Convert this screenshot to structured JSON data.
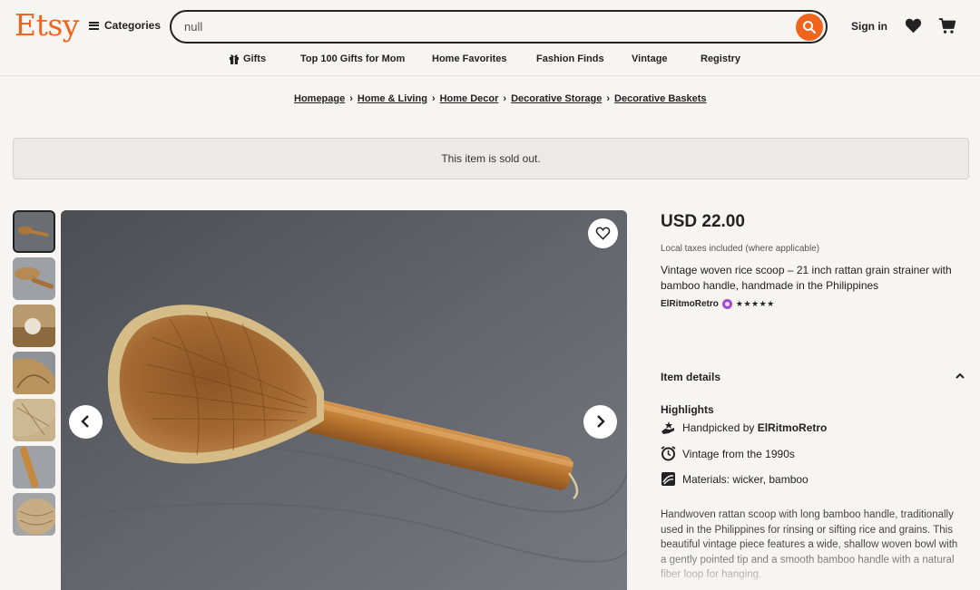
{
  "header": {
    "logo": "Etsy",
    "categories_label": "Categories",
    "search_value": "null",
    "signin_label": "Sign in"
  },
  "subnav": [
    "Gifts",
    "Top 100 Gifts for Mom",
    "Home Favorites",
    "Fashion Finds",
    "Vintage",
    "Registry"
  ],
  "breadcrumb": [
    "Homepage",
    "Home & Living",
    "Home Decor",
    "Decorative Storage",
    "Decorative Baskets"
  ],
  "banner": {
    "text": "This item is sold out."
  },
  "listing": {
    "price": "USD 22.00",
    "tax_note": "Local taxes included (where applicable)",
    "title": "Vintage woven rice scoop – 21 inch rattan grain strainer with bamboo handle, handmade in the Philippines",
    "shop_name": "ElRitmoRetro",
    "stars": "★★★★★"
  },
  "details": {
    "heading": "Item details",
    "highlights_heading": "Highlights",
    "handpicked_prefix": "Handpicked by ",
    "handpicked_shop": "ElRitmoRetro",
    "vintage": "Vintage from the 1990s",
    "materials": "Materials: wicker, bamboo",
    "description": "Handwoven rattan scoop with long bamboo handle, traditionally used in the Philippines for rinsing or sifting rice and grains. This beautiful vintage piece features a wide, shallow woven bowl with a gently pointed tip and a smooth bamboo handle with a natural fiber loop for hanging."
  },
  "colors": {
    "brand": "#f1641e",
    "star_seller": "#a34ad0"
  },
  "icons": [
    "hamburger-icon",
    "search-icon",
    "heart-icon",
    "cart-icon",
    "gift-icon",
    "chevron-left-icon",
    "chevron-right-icon",
    "chevron-up-icon",
    "hand-icon",
    "clock-icon",
    "material-icon"
  ]
}
